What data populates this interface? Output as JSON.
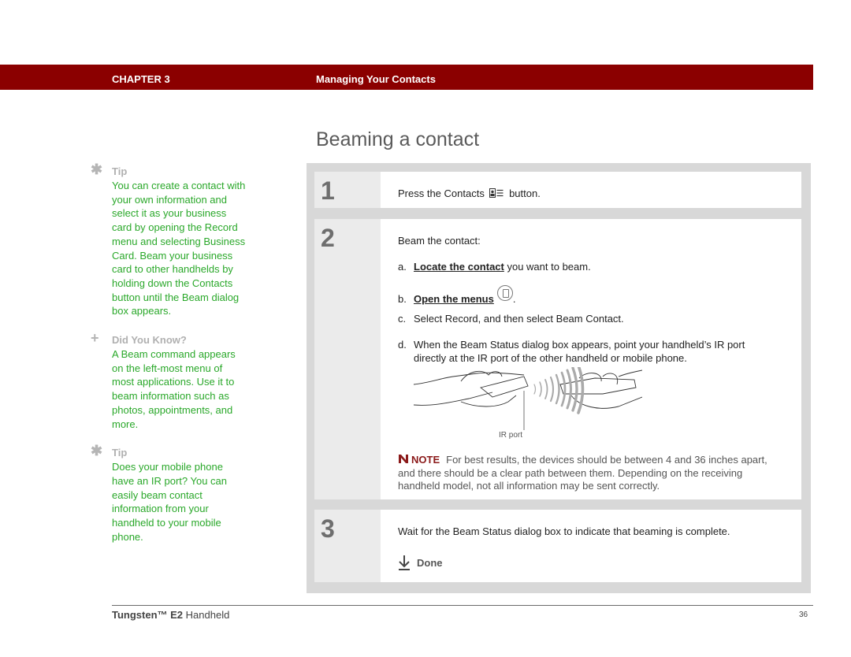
{
  "header": {
    "chapter": "CHAPTER 3",
    "title": "Managing Your Contacts",
    "bar_color": "#8b0000"
  },
  "page_title": "Beaming a contact",
  "sidebar": [
    {
      "icon": "asterisk-icon",
      "heading": "Tip",
      "body": "You can create a contact with your own information and select it as your business card by opening the Record menu and selecting Business Card. Beam your business card to other handhelds by holding down the Contacts button until the Beam dialog box appears."
    },
    {
      "icon": "plus-icon",
      "heading": "Did You Know?",
      "body": "A Beam command appears on the left-most menu of most applications. Use it to beam information such as photos, appointments, and more."
    },
    {
      "icon": "asterisk-icon",
      "heading": "Tip",
      "body": "Does your mobile phone have an IR port? You can easily beam contact information from your handheld to your mobile phone."
    }
  ],
  "steps": [
    {
      "number": "1",
      "text_before": "Press the Contacts",
      "icon": "contacts-button-icon",
      "text_after": "button."
    },
    {
      "number": "2",
      "intro": "Beam the contact:",
      "substeps": [
        {
          "label": "a.",
          "link": "Locate the contact",
          "text": " you want to beam."
        },
        {
          "label": "b.",
          "link": "Open the menus",
          "icon": "menu-icon",
          "text": "."
        },
        {
          "label": "c.",
          "text": "Select Record, and then select Beam Contact."
        },
        {
          "label": "d.",
          "text": "When the Beam Status dialog box appears, point your handheld’s IR port",
          "text2": "directly at the IR port of the other handheld or mobile phone."
        }
      ],
      "illustration_label": "IR port",
      "note": {
        "label": "NOTE",
        "text": "For best results, the devices should be between 4 and 36 inches apart, and there should be a clear path between them. Depending on the receiving handheld model, not all information may be sent correctly."
      }
    },
    {
      "number": "3",
      "text": "Wait for the Beam Status dialog box to indicate that beaming is complete.",
      "done_label": "Done"
    }
  ],
  "footer": {
    "product_bold": "Tungsten™ E2",
    "product_rest": " Handheld",
    "page_number": "36"
  },
  "colors": {
    "sidebar_text": "#2aa82a",
    "note_label": "#8b1a1a",
    "step_panel": "#d8d8d8"
  }
}
